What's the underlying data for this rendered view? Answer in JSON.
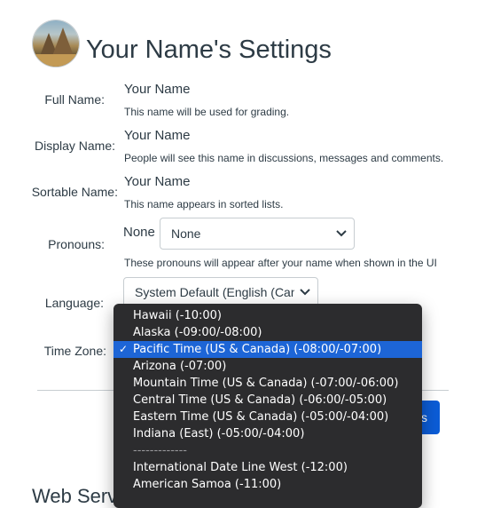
{
  "page": {
    "title": "Your Name's Settings"
  },
  "fields": {
    "full_name": {
      "label": "Full Name:",
      "value": "Your Name",
      "hint": "This name will be used for grading."
    },
    "display_name": {
      "label": "Display Name:",
      "value": "Your Name",
      "hint": "People will see this name in discussions, messages and comments."
    },
    "sortable_name": {
      "label": "Sortable Name:",
      "value": "Your Name",
      "hint": "This name appears in sorted lists."
    },
    "pronouns": {
      "label": "Pronouns:",
      "value": "None",
      "selected": "None",
      "hint": "These pronouns will appear after your name when shown in the UI"
    },
    "language": {
      "label": "Language:",
      "selected": "System Default (English (Cana"
    },
    "time_zone": {
      "label": "Time Zone:"
    }
  },
  "button": {
    "label": "s"
  },
  "bottom_heading": {
    "text": "Web Serv"
  },
  "timezone_dropdown": {
    "selected_index": 2,
    "check_mark": "✓",
    "items": [
      "Hawaii (-10:00)",
      "Alaska (-09:00/-08:00)",
      "Pacific Time (US & Canada) (-08:00/-07:00)",
      "Arizona (-07:00)",
      "Mountain Time (US & Canada) (-07:00/-06:00)",
      "Central Time (US & Canada) (-06:00/-05:00)",
      "Eastern Time (US & Canada) (-05:00/-04:00)",
      "Indiana (East) (-05:00/-04:00)",
      "-------------",
      "International Date Line West (-12:00)",
      "American Samoa (-11:00)"
    ]
  }
}
